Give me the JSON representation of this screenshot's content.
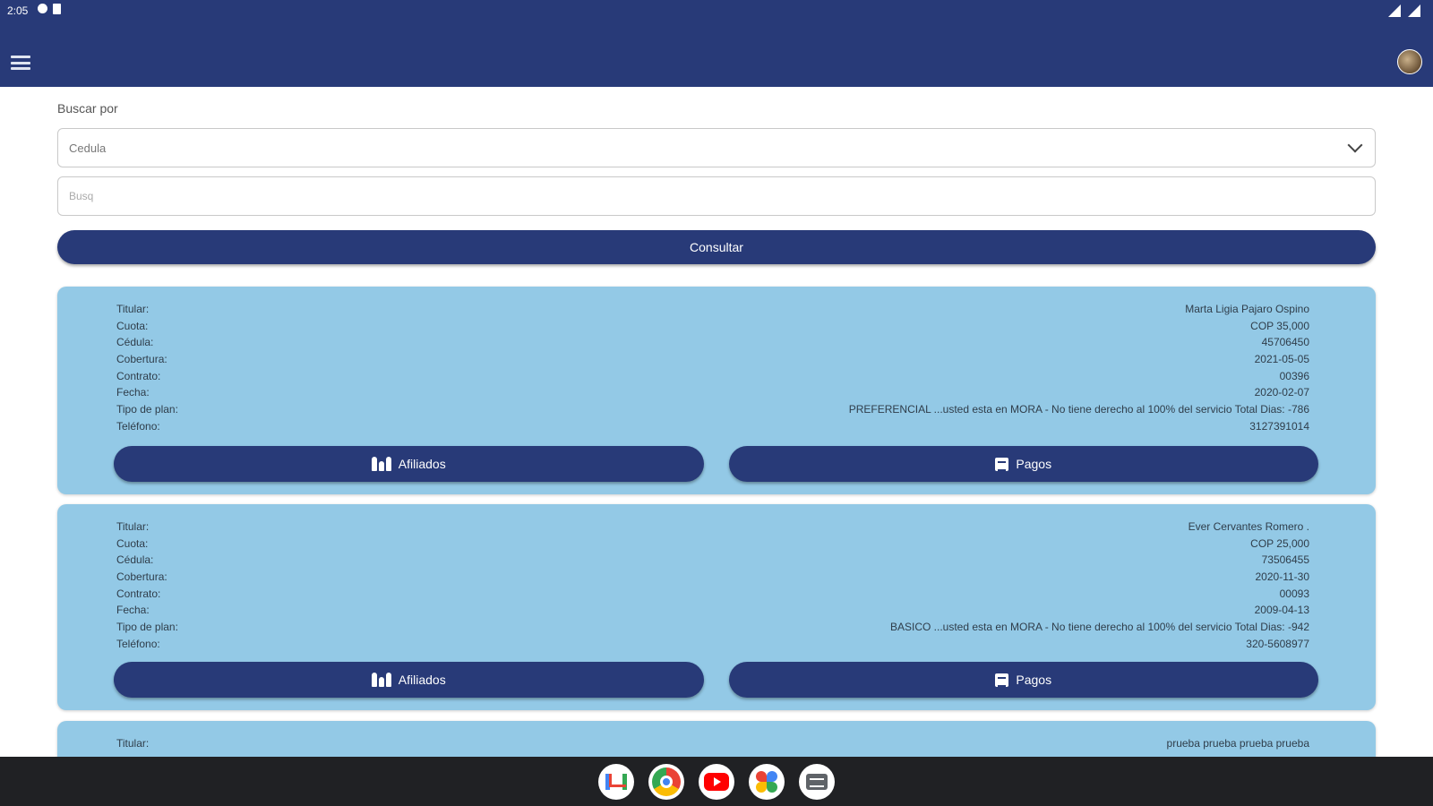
{
  "status_bar": {
    "time": "2:05"
  },
  "search": {
    "label": "Buscar por",
    "select_value": "Cedula",
    "input_placeholder": "Busq",
    "consult_label": "Consultar"
  },
  "field_labels": {
    "titular": "Titular:",
    "cuota": "Cuota:",
    "cedula": "Cédula:",
    "cobertura": "Cobertura:",
    "contrato": "Contrato:",
    "fecha": "Fecha:",
    "tipo_plan": "Tipo de plan:",
    "telefono": "Teléfono:"
  },
  "cards": [
    {
      "titular": "Marta Ligia Pajaro Ospino",
      "cuota": "COP 35,000",
      "cedula": "45706450",
      "cobertura": "2021-05-05",
      "contrato": "00396",
      "fecha": "2020-02-07",
      "tipo_plan": "PREFERENCIAL ...usted esta en MORA - No tiene derecho al 100% del servicio Total Dias: -786",
      "telefono": "3127391014",
      "afiliados_label": "Afiliados",
      "pagos_label": "Pagos"
    },
    {
      "titular": "Ever Cervantes Romero .",
      "cuota": "COP 25,000",
      "cedula": "73506455",
      "cobertura": "2020-11-30",
      "contrato": "00093",
      "fecha": "2009-04-13",
      "tipo_plan": "BASICO ...usted esta en MORA - No tiene derecho al 100% del servicio Total Dias: -942",
      "telefono": "320-5608977",
      "afiliados_label": "Afiliados",
      "pagos_label": "Pagos"
    },
    {
      "titular": "prueba prueba prueba prueba"
    }
  ],
  "taskbar": {
    "apps": [
      "gmail-icon",
      "chrome-icon",
      "youtube-icon",
      "photos-icon",
      "messages-icon"
    ]
  }
}
